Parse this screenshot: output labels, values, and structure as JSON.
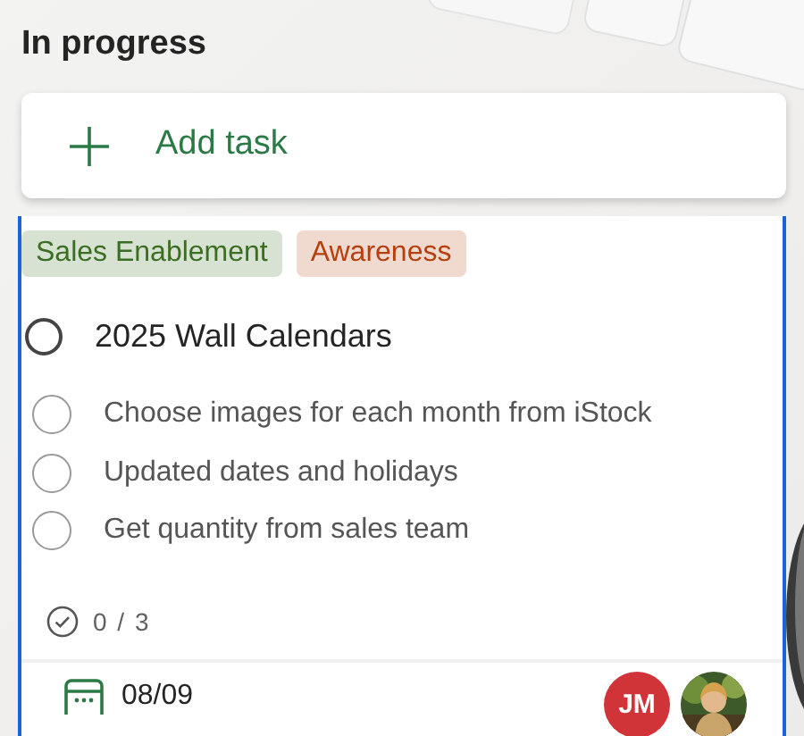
{
  "column": {
    "title": "In progress",
    "add_task": {
      "label": "Add task"
    }
  },
  "task": {
    "selected": true,
    "labels": [
      {
        "text": "Sales Enablement",
        "color": "#3b6e22"
      },
      {
        "text": "Awareness",
        "color": "#b5400e"
      }
    ],
    "title": "2025 Wall Calendars",
    "completed": false,
    "checklist": [
      {
        "text": "Choose images for each month from iStock",
        "checked": false
      },
      {
        "text": "Updated dates and holidays",
        "checked": false
      },
      {
        "text": "Get quantity from sales team",
        "checked": false
      }
    ],
    "progress": "0 / 3",
    "due_date": "08/09",
    "assignees": [
      {
        "kind": "initials",
        "initials": "JM",
        "color": "#d13438"
      },
      {
        "kind": "picture"
      }
    ]
  }
}
